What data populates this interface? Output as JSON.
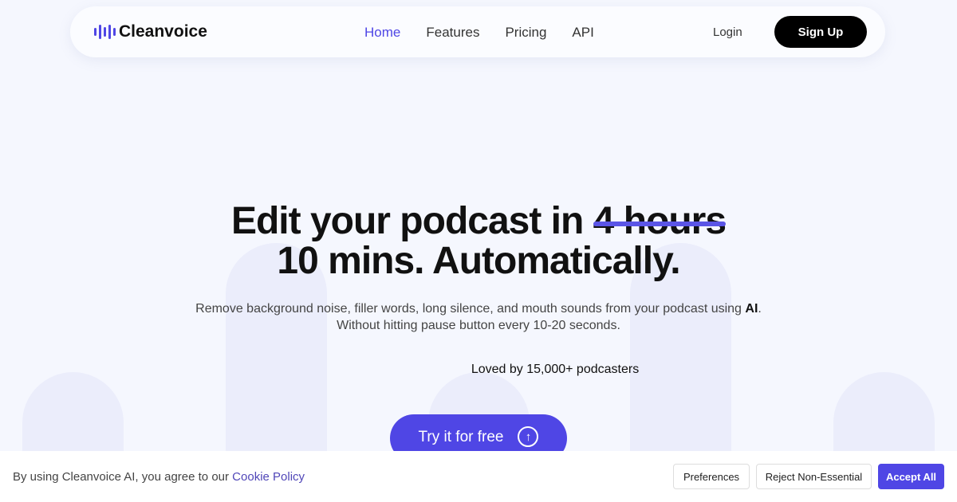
{
  "brand": {
    "name": "Cleanvoice",
    "accent": "#4f46e5"
  },
  "nav": {
    "links": [
      {
        "label": "Home",
        "active": true
      },
      {
        "label": "Features"
      },
      {
        "label": "Pricing"
      },
      {
        "label": "API"
      }
    ],
    "login": "Login",
    "signup": "Sign Up"
  },
  "hero": {
    "title_part1": "Edit your podcast in ",
    "title_struck": "4 hours",
    "title_line2": "10 mins. Automatically.",
    "subtitle_part1": "Remove background noise, filler words, long silence, and mouth sounds from your podcast using ",
    "subtitle_bold": "AI",
    "subtitle_part2": ".",
    "subtitle_line2": "Without hitting pause button every 10-20 seconds.",
    "social_proof": "Loved by 15,000+ podcasters",
    "cta": "Try it for free",
    "cta_icon": "arrow-up-circle-icon"
  },
  "cookie": {
    "text": "By using Cleanvoice AI, you agree to our ",
    "link": "Cookie Policy",
    "preferences": "Preferences",
    "reject": "Reject Non-Essential",
    "accept": "Accept All"
  }
}
